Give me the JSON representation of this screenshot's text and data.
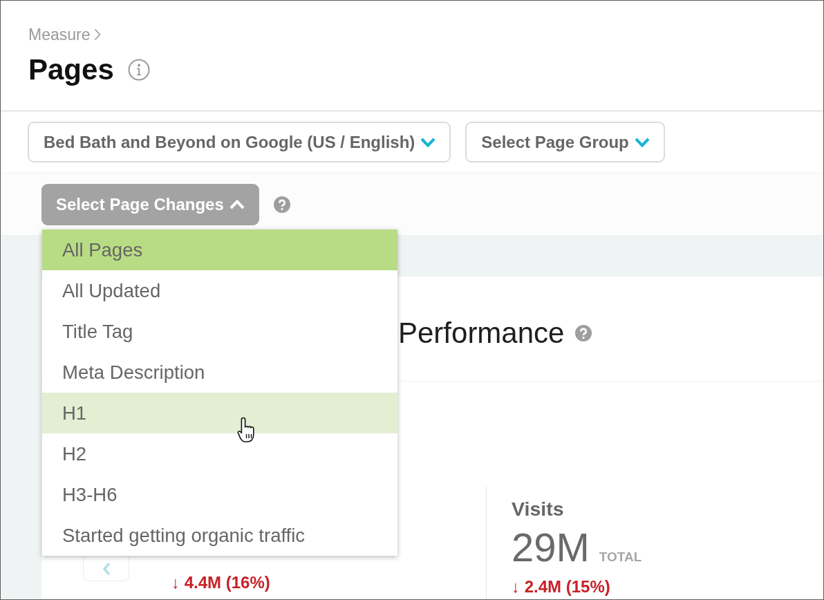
{
  "breadcrumb": {
    "label": "Measure"
  },
  "page_title": "Pages",
  "filters": [
    {
      "label": "Bed Bath and Beyond on Google (US / English)"
    },
    {
      "label": "Select Page Group"
    }
  ],
  "page_changes": {
    "label": "Select Page Changes",
    "expanded": true,
    "options": [
      {
        "label": "All Pages",
        "selected": true,
        "highlighted": false
      },
      {
        "label": "All Updated",
        "selected": false,
        "highlighted": false
      },
      {
        "label": "Title Tag",
        "selected": false,
        "highlighted": false
      },
      {
        "label": "Meta Description",
        "selected": false,
        "highlighted": false
      },
      {
        "label": "H1",
        "selected": false,
        "highlighted": true
      },
      {
        "label": "H2",
        "selected": false,
        "highlighted": false
      },
      {
        "label": "H3-H6",
        "selected": false,
        "highlighted": false
      },
      {
        "label": "Started getting organic traffic",
        "selected": false,
        "highlighted": false
      }
    ]
  },
  "panel": {
    "title": "Performance"
  },
  "metrics": [
    {
      "change": "↓ 4.4M (16%)"
    },
    {
      "name": "Visits",
      "value": "29M",
      "unit": "TOTAL",
      "change": "↓ 2.4M (15%)"
    }
  ]
}
